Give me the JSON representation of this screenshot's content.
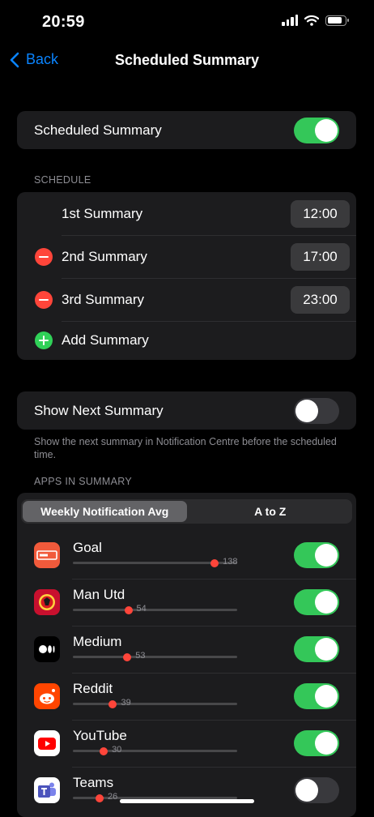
{
  "status_bar": {
    "time": "20:59"
  },
  "nav": {
    "back_label": "Back",
    "title": "Scheduled Summary"
  },
  "main_toggle": {
    "label": "Scheduled Summary",
    "on": true
  },
  "schedule": {
    "header": "SCHEDULE",
    "items": [
      {
        "label": "1st Summary",
        "time": "12:00",
        "removable": false
      },
      {
        "label": "2nd Summary",
        "time": "17:00",
        "removable": true
      },
      {
        "label": "3rd Summary",
        "time": "23:00",
        "removable": true
      }
    ],
    "add_label": "Add Summary"
  },
  "next_summary": {
    "label": "Show Next Summary",
    "on": false,
    "footnote": "Show the next summary in Notification Centre before the scheduled time."
  },
  "apps": {
    "header": "APPS IN SUMMARY",
    "segments": [
      "Weekly Notification Avg",
      "A to Z"
    ],
    "selected_segment": 0,
    "scale_max": 160,
    "items": [
      {
        "name": "Goal",
        "count": "138",
        "value": 138,
        "on": true,
        "icon": "goal-icon"
      },
      {
        "name": "Man Utd",
        "count": "54",
        "value": 54,
        "on": true,
        "icon": "man-utd-icon"
      },
      {
        "name": "Medium",
        "count": "53",
        "value": 53,
        "on": true,
        "icon": "medium-icon"
      },
      {
        "name": "Reddit",
        "count": "39",
        "value": 39,
        "on": true,
        "icon": "reddit-icon"
      },
      {
        "name": "YouTube",
        "count": "30",
        "value": 30,
        "on": true,
        "icon": "youtube-icon"
      },
      {
        "name": "Teams",
        "count": "26",
        "value": 26,
        "on": false,
        "icon": "teams-icon"
      }
    ]
  },
  "colors": {
    "accent": "#0a84ff",
    "toggle_on": "#34c759",
    "remove": "#ff453a",
    "add": "#30d158",
    "dot": "#ff453a"
  }
}
